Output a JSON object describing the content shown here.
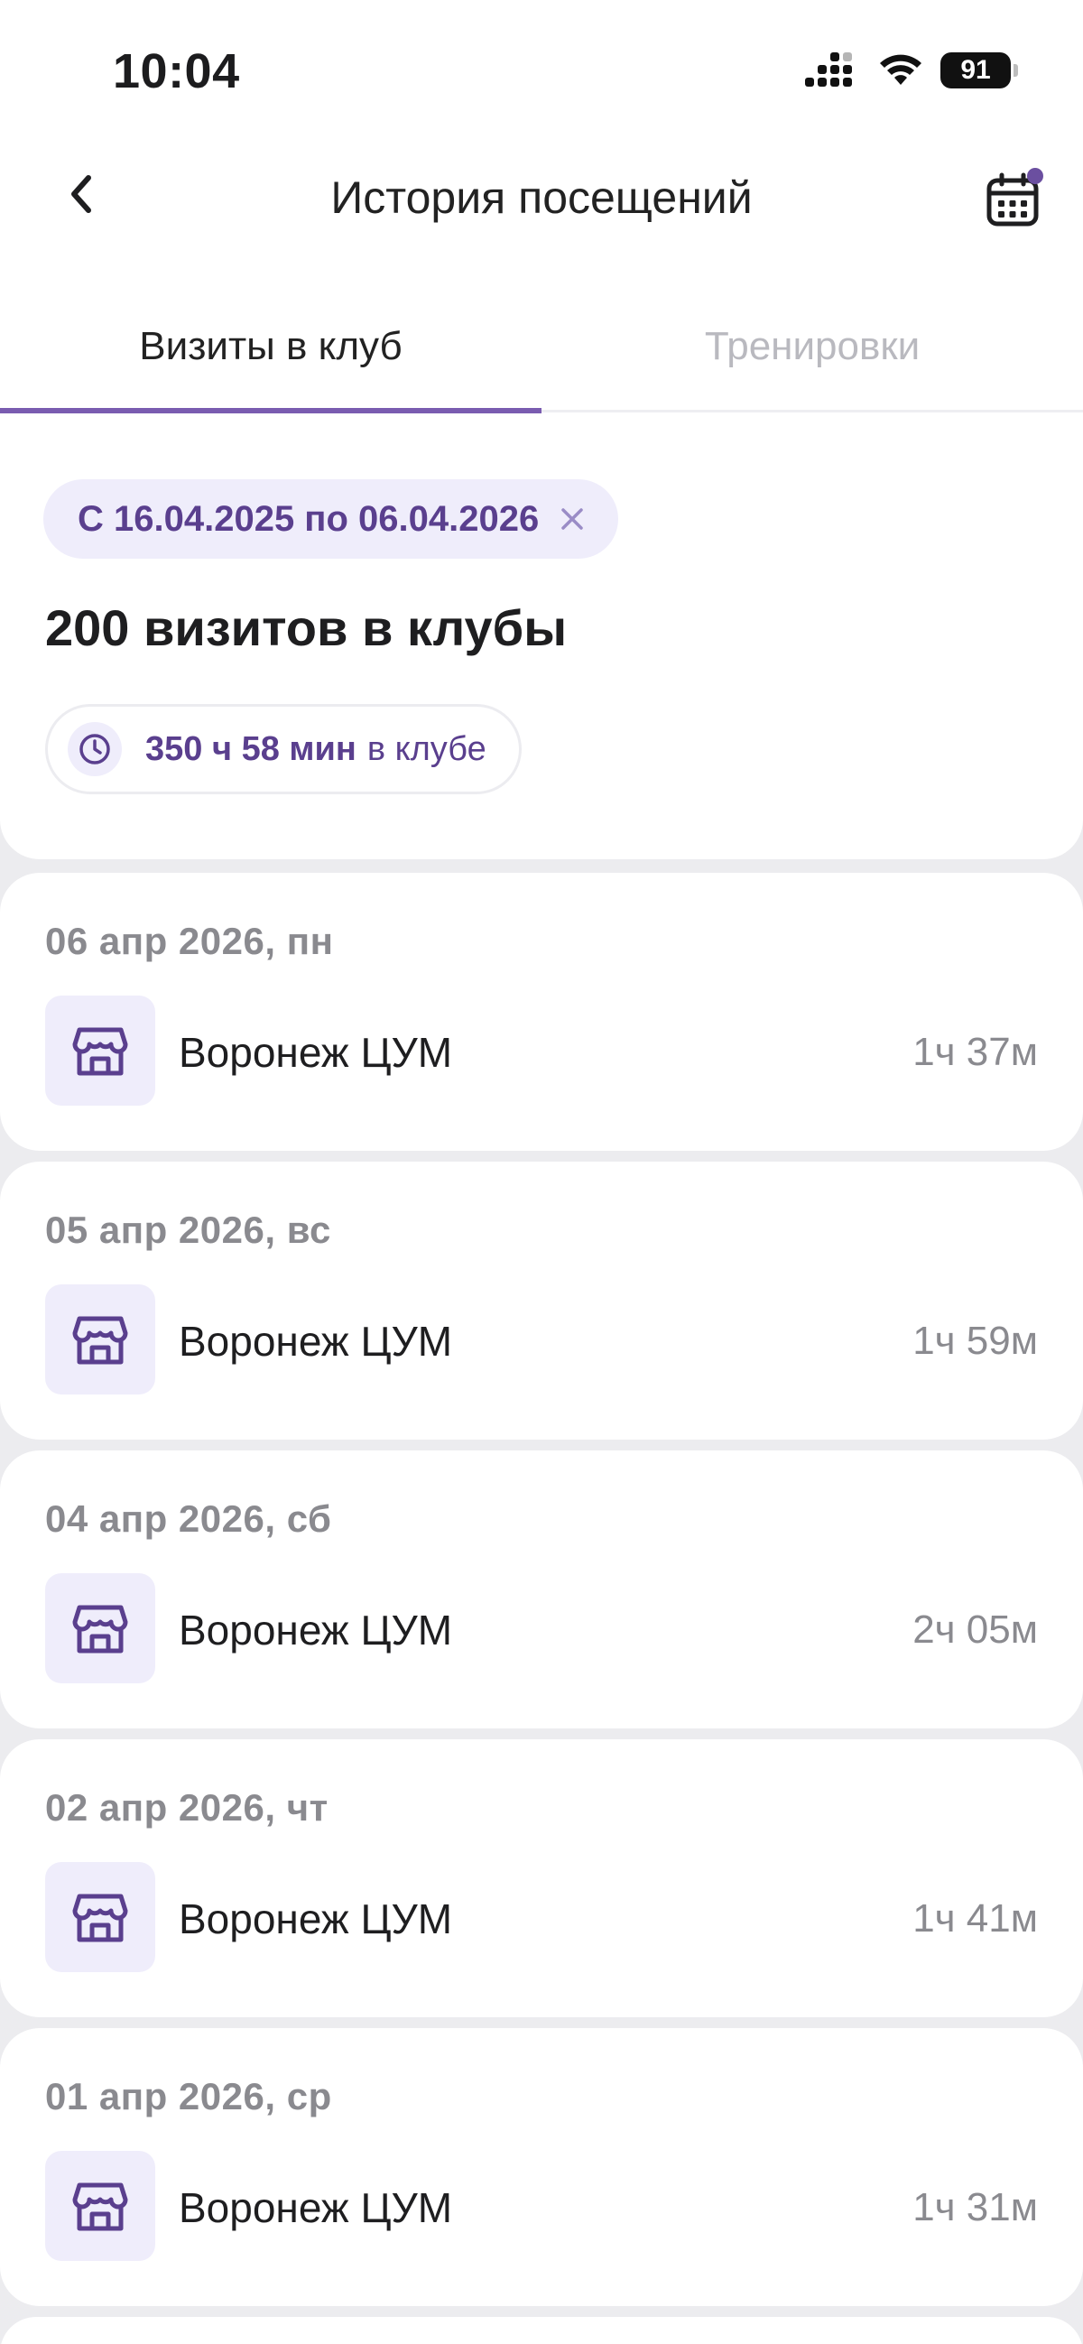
{
  "status_bar": {
    "time": "10:04",
    "battery": "91"
  },
  "header": {
    "title": "История посещений",
    "back_icon": "chevron-left-icon",
    "calendar_icon": "calendar-icon"
  },
  "tabs": [
    {
      "label": "Визиты в клуб",
      "active": true
    },
    {
      "label": "Тренировки",
      "active": false
    }
  ],
  "filter": {
    "label": "С 16.04.2025 по 06.04.2026"
  },
  "summary": {
    "title": "200 визитов в клубы",
    "time_value": "350 ч 58 мин",
    "time_suffix": "в клубе"
  },
  "visits": [
    {
      "date": "06 апр 2026, пн",
      "club": "Воронеж ЦУМ",
      "duration": "1ч 37м"
    },
    {
      "date": "05 апр 2026, вс",
      "club": "Воронеж ЦУМ",
      "duration": "1ч 59м"
    },
    {
      "date": "04 апр 2026, сб",
      "club": "Воронеж ЦУМ",
      "duration": "2ч 05м"
    },
    {
      "date": "02 апр 2026, чт",
      "club": "Воронеж ЦУМ",
      "duration": "1ч 41м"
    },
    {
      "date": "01 апр 2026, ср",
      "club": "Воронеж ЦУМ",
      "duration": "1ч 31м"
    }
  ],
  "colors": {
    "accent": "#5a3f8e",
    "accent_light": "#efedfb",
    "tab_indicator": "#7a5cb0",
    "background": "#ececef"
  }
}
